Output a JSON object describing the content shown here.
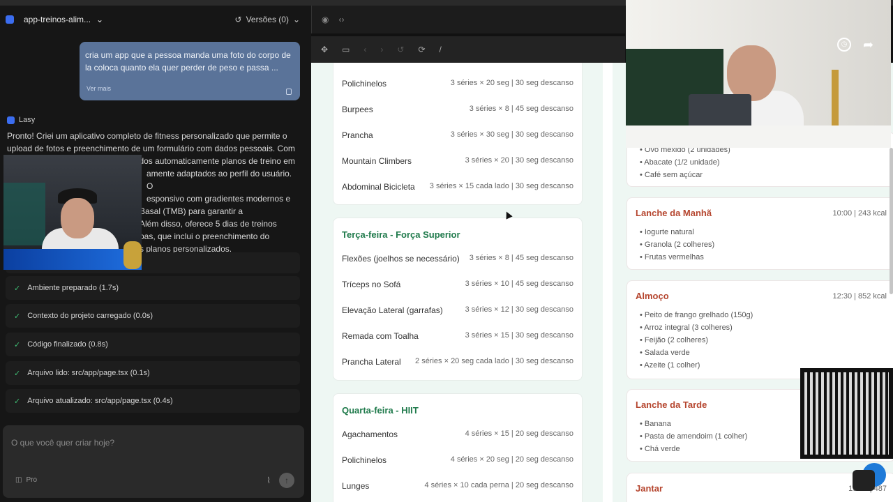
{
  "header": {
    "project_name": "app-treinos-alim...",
    "versions_label": "Versões (0)"
  },
  "chat": {
    "user_message": "cria um app que a pessoa manda uma foto do corpo de la coloca quanto ela quer perder de peso e passa ...",
    "see_more": "Ver mais",
    "agent_name": "Lasy",
    "agent_reply_lines": [
      "Pronto! Criei um aplicativo completo de fitness personalizado que permite o",
      "upload de fotos e preenchimento de um formulário com dados pessoais. Com",
      "base nessas informações, são gerados automaticamente planos de treino em",
      "amente adaptados ao perfil do usuário. O",
      "esponsivo com gradientes modernos e",
      "Basal (TMB) para garantir a",
      "Além disso, oferece 5 dias de treinos",
      "pas, que inclui o preenchimento do",
      "s planos personalizados."
    ],
    "steps": [
      "Ambiente preparado (1.7s)",
      "Contexto do projeto carregado (0.0s)",
      "Código finalizado (0.8s)",
      "Arquivo lido: src/app/page.tsx (0.1s)",
      "Arquivo atualizado: src/app/page.tsx (0.4s)"
    ],
    "input_placeholder": "O que você quer criar hoje?",
    "model_label": "Pro"
  },
  "workouts": {
    "monday": [
      {
        "name": "Polichinelos",
        "detail": "3 séries × 20 seg | 30 seg descanso"
      },
      {
        "name": "Burpees",
        "detail": "3 séries × 8 | 45 seg descanso"
      },
      {
        "name": "Prancha",
        "detail": "3 séries × 30 seg | 30 seg descanso"
      },
      {
        "name": "Mountain Climbers",
        "detail": "3 séries × 20 | 30 seg descanso"
      },
      {
        "name": "Abdominal Bicicleta",
        "detail": "3 séries × 15 cada lado | 30 seg descanso"
      }
    ],
    "tuesday_title": "Terça-feira - Força Superior",
    "tuesday": [
      {
        "name": "Flexões (joelhos se necessário)",
        "detail": "3 séries × 8 | 45 seg descanso"
      },
      {
        "name": "Tríceps no Sofá",
        "detail": "3 séries × 10 | 45 seg descanso"
      },
      {
        "name": "Elevação Lateral (garrafas)",
        "detail": "3 séries × 12 | 30 seg descanso"
      },
      {
        "name": "Remada com Toalha",
        "detail": "3 séries × 15 | 30 seg descanso"
      },
      {
        "name": "Prancha Lateral",
        "detail": "2 séries × 20 seg cada lado | 30 seg descanso"
      }
    ],
    "wednesday_title": "Quarta-feira - HIIT",
    "wednesday": [
      {
        "name": "Agachamentos",
        "detail": "4 séries × 15 | 20 seg descanso"
      },
      {
        "name": "Polichinelos",
        "detail": "4 séries × 20 seg | 20 seg descanso"
      },
      {
        "name": "Lunges",
        "detail": "4 séries × 10 cada perna | 20 seg descanso"
      }
    ]
  },
  "meals": {
    "breakfast_items": [
      "Ovo mexido (2 unidades)",
      "Abacate (1/2 unidade)",
      "Café sem açúcar"
    ],
    "morning_snack": {
      "title": "Lanche da Manhã",
      "meta": "10:00 | 243 kcal",
      "items": [
        "Iogurte natural",
        "Granola (2 colheres)",
        "Frutas vermelhas"
      ]
    },
    "lunch": {
      "title": "Almoço",
      "meta": "12:30 | 852 kcal",
      "items": [
        "Peito de frango grelhado (150g)",
        "Arroz integral (3 colheres)",
        "Feijão (2 colheres)",
        "Salada verde",
        "Azeite (1 colher)"
      ]
    },
    "afternoon_snack": {
      "title": "Lanche da Tarde",
      "items": [
        "Banana",
        "Pasta de amendoim (1 colher)",
        "Chá verde"
      ]
    },
    "dinner": {
      "title": "Jantar",
      "meta": "19:00 | 487"
    }
  }
}
